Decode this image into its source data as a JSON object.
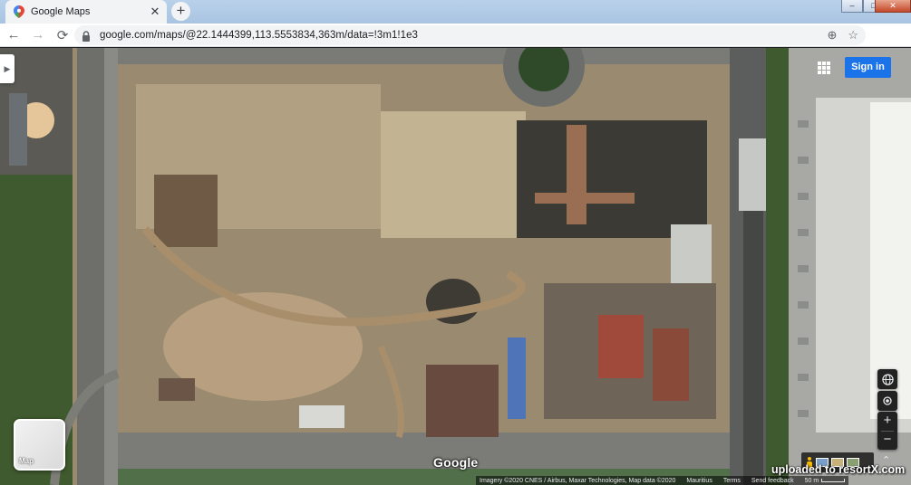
{
  "browser": {
    "tab_title": "Google Maps",
    "tab_close": "✕",
    "new_tab": "+",
    "back": "←",
    "forward": "→",
    "reload": "⟳",
    "url": "google.com/maps/@22.1444399,113.5553834,363m/data=!3m1!1e3",
    "window_controls": [
      "–",
      "□",
      "✕"
    ],
    "menu": "⋮",
    "icons": [
      "lock-icon",
      "add-to-reading-icon",
      "star-icon",
      "profile-icon"
    ]
  },
  "map": {
    "sign_in": "Sign in",
    "panel_toggle": "▶",
    "layer_toggle_label": "Map",
    "zoom_in": "+",
    "zoom_out": "−",
    "logo": "Google",
    "attribution": "Imagery ©2020 CNES / Airbus, Maxar Technologies, Map data ©2020",
    "footer_links": [
      "Mauritius",
      "Terms",
      "Send feedback"
    ],
    "scale": "50 m",
    "expand": "⌃",
    "icons": [
      "globe-icon",
      "my-location-icon",
      "pegman-icon",
      "apps-grid-icon"
    ]
  },
  "watermark": "uploaded to resortX.com",
  "colors": {
    "accent": "#1a73e8",
    "control_bg": "#222222",
    "tab_bg": "#f1f3f4"
  }
}
